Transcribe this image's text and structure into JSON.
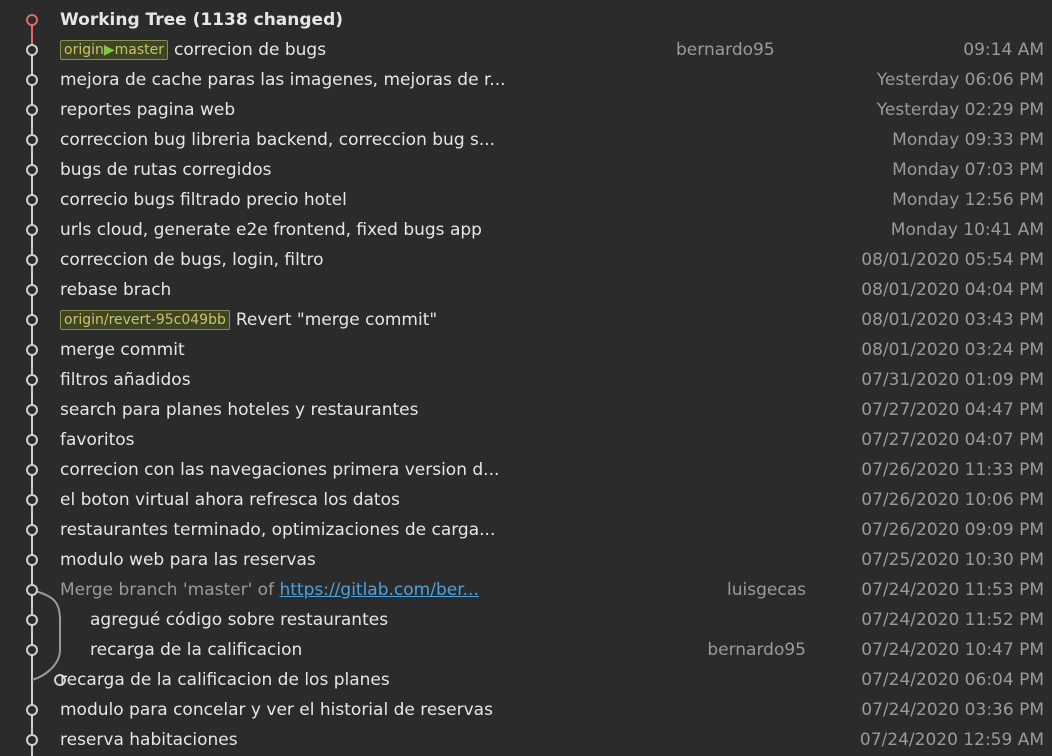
{
  "colors": {
    "background": "#2b2b2b",
    "working_tree_node": "#e06a6a",
    "graph_line": "#cfcfcf",
    "link": "#4aa3df",
    "tag_text": "#c9c46a"
  },
  "working_tree": {
    "label": "Working Tree (1138 changed)"
  },
  "commits": [
    {
      "tags": [
        {
          "prefix": "origin",
          "icon": "play-icon",
          "name": "master"
        }
      ],
      "message": "correcion de bugs",
      "author": "bernardo95",
      "date": "09:14 AM"
    },
    {
      "message": "mejora de cache paras las imagenes, mejoras de r...",
      "date": "Yesterday 06:06 PM"
    },
    {
      "message": "reportes pagina web",
      "date": "Yesterday 02:29 PM"
    },
    {
      "message": "correccion bug libreria backend, correccion bug s...",
      "date": "Monday 09:33 PM"
    },
    {
      "message": "bugs de rutas corregidos",
      "date": "Monday 07:03 PM"
    },
    {
      "message": "correcio bugs filtrado precio hotel",
      "date": "Monday 12:56 PM"
    },
    {
      "message": "urls cloud, generate e2e frontend, fixed bugs app",
      "date": "Monday 10:41 AM"
    },
    {
      "message": "correccion de bugs, login, filtro",
      "date": "08/01/2020 05:54 PM"
    },
    {
      "message": "rebase brach",
      "date": "08/01/2020 04:04 PM"
    },
    {
      "tags": [
        {
          "name": "origin/revert-95c049bb"
        }
      ],
      "message": "Revert \"merge commit\"",
      "date": "08/01/2020 03:43 PM"
    },
    {
      "message": "merge commit",
      "date": "08/01/2020 03:24 PM"
    },
    {
      "message": "filtros añadidos",
      "date": "07/31/2020 01:09 PM"
    },
    {
      "message": "search para planes hoteles y restaurantes",
      "date": "07/27/2020 04:47 PM"
    },
    {
      "message": "favoritos",
      "date": "07/27/2020 04:07 PM"
    },
    {
      "message": "correcion con las navegaciones primera version d...",
      "date": "07/26/2020 11:33 PM"
    },
    {
      "message": "el boton virtual ahora refresca los datos",
      "date": "07/26/2020 10:06 PM"
    },
    {
      "message": "restaurantes terminado, optimizaciones de carga...",
      "date": "07/26/2020 09:09 PM"
    },
    {
      "message": "modulo web para las reservas",
      "date": "07/25/2020 10:30 PM"
    },
    {
      "message": "Merge branch 'master' of ",
      "link": "https://gitlab.com/ber...",
      "dim": true,
      "author": "luisgecas",
      "date": "07/24/2020 11:53 PM"
    },
    {
      "message": "agregué código sobre restaurantes",
      "indent": true,
      "date": "07/24/2020 11:52 PM"
    },
    {
      "message": "recarga de la calificacion",
      "indent": true,
      "author": "bernardo95",
      "date": "07/24/2020 10:47 PM"
    },
    {
      "message": "recarga de la calificacion de los planes",
      "date": "07/24/2020 06:04 PM"
    },
    {
      "message": "modulo para concelar y ver el historial de reservas",
      "date": "07/24/2020 03:36 PM"
    },
    {
      "message": "reserva habitaciones",
      "date": "07/24/2020 12:59 AM"
    }
  ]
}
